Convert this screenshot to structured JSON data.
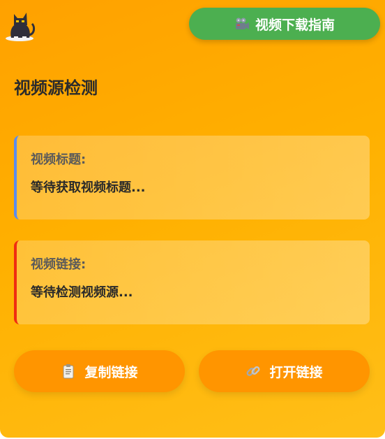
{
  "header": {
    "guide_button_label": "视频下载指南",
    "guide_button_icon": "film-camera-icon",
    "logo_icon": "cat-icon"
  },
  "main": {
    "heading": "视频源检测",
    "title_card": {
      "label": "视频标题:",
      "value": "等待获取视频标题...",
      "accent_color": "#5b8def"
    },
    "link_card": {
      "label": "视频链接:",
      "value": "等待检测视频源...",
      "accent_color": "#f02d10"
    }
  },
  "actions": {
    "copy_label": "复制链接",
    "copy_icon": "clipboard-icon",
    "open_label": "打开链接",
    "open_icon": "link-icon"
  },
  "colors": {
    "background_start": "#ffa100",
    "background_end": "#ffbf18",
    "guide_button": "#4caf50",
    "action_button": "#ff9500"
  }
}
